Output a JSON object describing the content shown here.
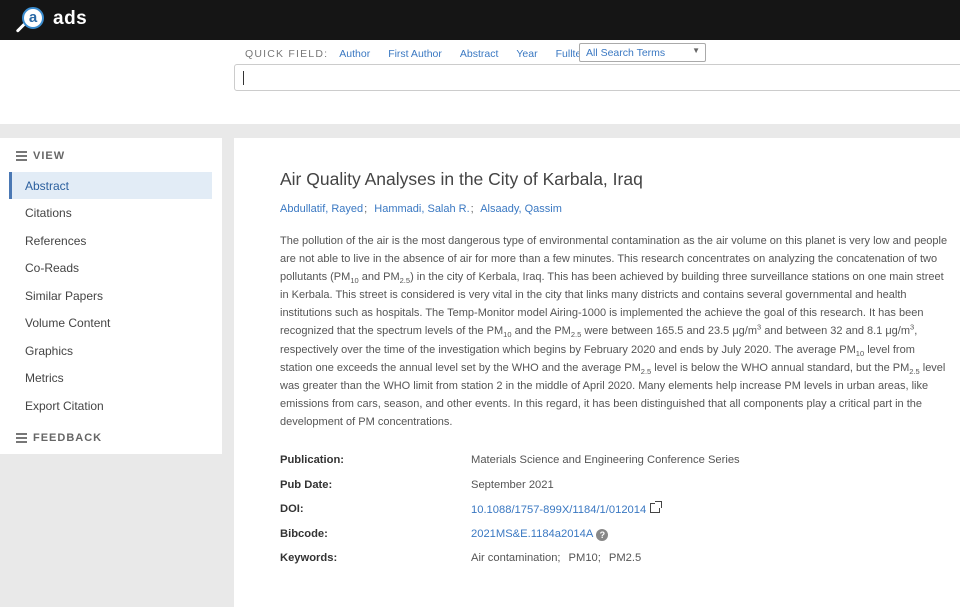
{
  "brand": "ads",
  "quick_field": {
    "label": "QUICK FIELD:",
    "links": [
      "Author",
      "First Author",
      "Abstract",
      "Year",
      "Fulltext"
    ],
    "select_value": "All Search Terms"
  },
  "search": {
    "value": ""
  },
  "sidebar": {
    "view_heading": "VIEW",
    "items": [
      "Abstract",
      "Citations",
      "References",
      "Co-Reads",
      "Similar Papers",
      "Volume Content",
      "Graphics",
      "Metrics",
      "Export Citation"
    ],
    "active_item": "Abstract",
    "feedback_heading": "FEEDBACK"
  },
  "paper": {
    "title": "Air Quality Analyses in the City of Karbala, Iraq",
    "authors": [
      "Abdullatif, Rayed",
      "Hammadi, Salah R.",
      "Alsaady, Qassim"
    ],
    "abstract": {
      "t1": "The pollution of the air is the most dangerous type of environmental contamination as the air volume on this planet is very low and people are not able to live in the absence of air for more than a few minutes. This research concentrates on analyzing the concatenation of two pollutants (PM",
      "t2": " and PM",
      "t3": ") in the city of Kerbala, Iraq. This has been achieved by building three surveillance stations on one main street in Kerbala. This street is considered is very vital in the city that links many districts and contains several governmental and health institutions such as hospitals. The Temp-Monitor model Airing-1000 is implemented the achieve the goal of this research. It has been recognized that the spectrum levels of the PM",
      "t4": " and the PM",
      "t5": " were between 165.5 and 23.5 μg/m",
      "t6": " and between 32 and 8.1 μg/m",
      "t7": ", respectively over the time of the investigation which begins by February 2020 and ends by July 2020. The average PM",
      "t8": " level from station one exceeds the annual level set by the WHO and the average PM",
      "t9": " level is below the WHO annual standard, but the PM",
      "t10": " level was greater than the WHO limit from station 2 in the middle of April 2020. Many elements help increase PM levels in urban areas, like emissions from cars, season, and other events. In this regard, it has been distinguished that all components play a critical part in the development of PM concentrations.",
      "sub10": "10",
      "sub25": "2.5",
      "sup3": "3"
    },
    "meta": {
      "publication_label": "Publication:",
      "publication": "Materials Science and Engineering Conference Series",
      "pubdate_label": "Pub Date:",
      "pubdate": "September 2021",
      "doi_label": "DOI:",
      "doi": "10.1088/1757-899X/1184/1/012014",
      "bibcode_label": "Bibcode:",
      "bibcode": "2021MS&E.1184a2014A",
      "keywords_label": "Keywords:",
      "keywords": [
        "Air contamination;",
        "PM10;",
        "PM2.5"
      ]
    }
  },
  "colors": {
    "link": "#3a78c2",
    "topbar": "#151515",
    "active_bg": "#e2ecf6"
  },
  "icons": [
    "ads-logo-icon",
    "list-icon",
    "external-link-icon",
    "help-icon",
    "chevron-down-icon"
  ]
}
